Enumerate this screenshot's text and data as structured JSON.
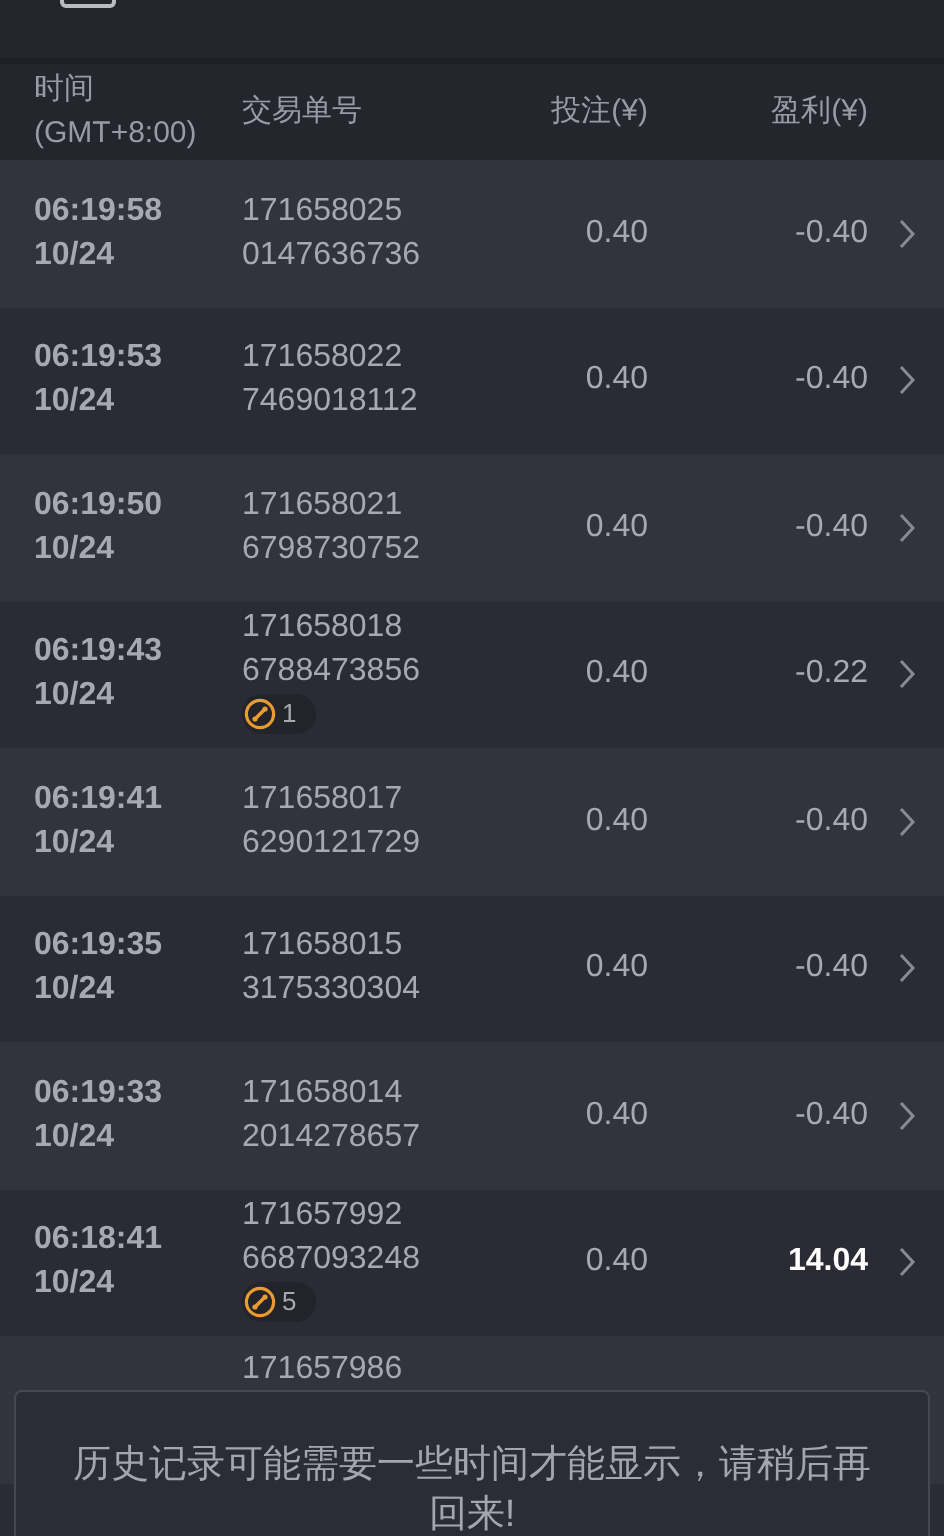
{
  "columns": [
    "时间\n(GMT+8:00)",
    "交易单号",
    "投注(¥)",
    "盈利(¥)"
  ],
  "rows": [
    {
      "time": "06:19:58",
      "date": "10/24",
      "order_1": "171658025",
      "order_2": "0147636736",
      "stake": "0.40",
      "profit": "-0.40",
      "win": false
    },
    {
      "time": "06:19:53",
      "date": "10/24",
      "order_1": "171658022",
      "order_2": "7469018112",
      "stake": "0.40",
      "profit": "-0.40",
      "win": false
    },
    {
      "time": "06:19:50",
      "date": "10/24",
      "order_1": "171658021",
      "order_2": "6798730752",
      "stake": "0.40",
      "profit": "-0.40",
      "win": false
    },
    {
      "time": "06:19:43",
      "date": "10/24",
      "order_1": "171658018",
      "order_2": "6788473856",
      "badge": "1",
      "stake": "0.40",
      "profit": "-0.22",
      "win": false
    },
    {
      "time": "06:19:41",
      "date": "10/24",
      "order_1": "171658017",
      "order_2": "6290121729",
      "stake": "0.40",
      "profit": "-0.40",
      "win": false
    },
    {
      "time": "06:19:35",
      "date": "10/24",
      "order_1": "171658015",
      "order_2": "3175330304",
      "stake": "0.40",
      "profit": "-0.40",
      "win": false
    },
    {
      "time": "06:19:33",
      "date": "10/24",
      "order_1": "171658014",
      "order_2": "2014278657",
      "stake": "0.40",
      "profit": "-0.40",
      "win": false
    },
    {
      "time": "06:18:41",
      "date": "10/24",
      "order_1": "171657992",
      "order_2": "6687093248",
      "badge": "5",
      "stake": "0.40",
      "profit": "14.04",
      "win": true
    },
    {
      "order_1": "171657986"
    }
  ],
  "toast": "历史记录可能需要一些时间才能显示，请稍后再回来!"
}
